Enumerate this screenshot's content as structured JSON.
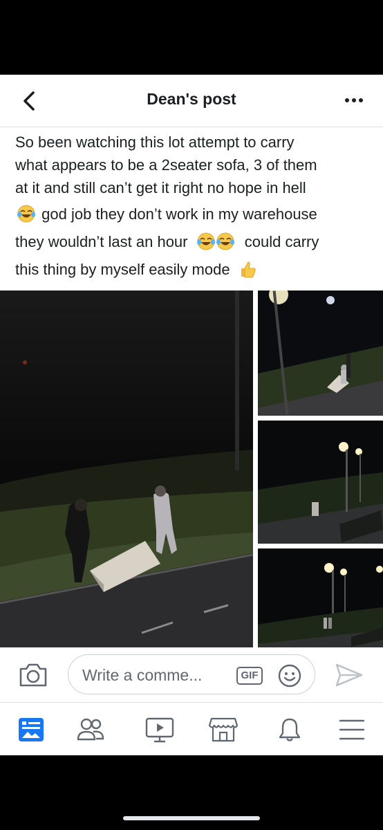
{
  "header": {
    "title": "Dean's post",
    "back_icon": "chevron-left-icon",
    "more_icon": "more-horizontal-icon"
  },
  "post": {
    "lines": [
      "So been watching this lot attempt to carry",
      "what appears to be a 2seater sofa, 3 of them",
      "at it and still can’t get it right no hope in hell",
      "god job they don’t work in my warehouse",
      "they wouldn’t last an hour",
      "could carry",
      "this thing by myself easily mode"
    ],
    "emojis": [
      "face-with-tears-of-joy",
      "face-with-tears-of-joy",
      "face-with-tears-of-joy",
      "thumbs-up"
    ]
  },
  "photos": [
    {
      "description_icon": "photo-night-street-sofa"
    },
    {
      "description_icon": "photo-night-streetlamp"
    },
    {
      "description_icon": "photo-night-streetlights"
    },
    {
      "description_icon": "photo-night-street-people"
    }
  ],
  "comment": {
    "placeholder": "Write a comme...",
    "gif_label": "GIF"
  },
  "nav": {
    "items": [
      "news-feed-icon",
      "friends-icon",
      "watch-icon",
      "marketplace-icon",
      "notifications-icon",
      "menu-icon"
    ],
    "active_color": "#1877f2",
    "inactive_color": "#606770"
  }
}
